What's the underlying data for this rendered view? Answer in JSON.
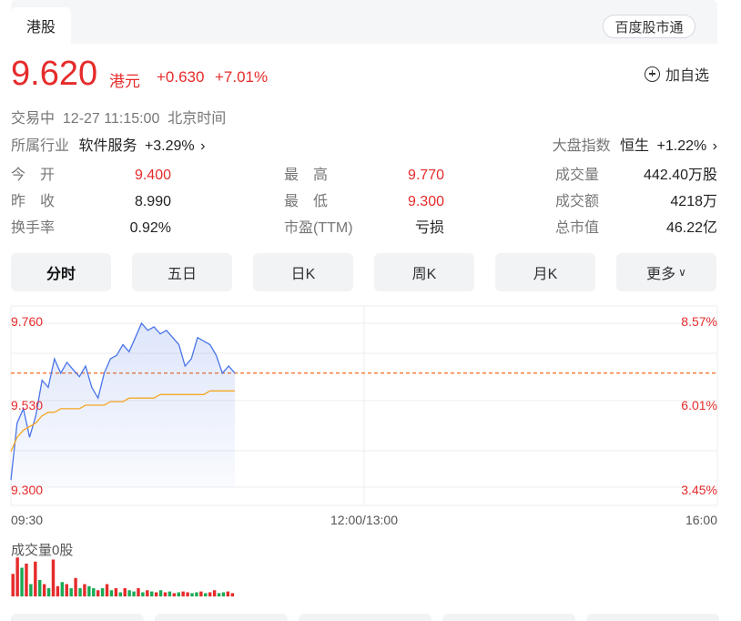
{
  "header": {
    "tab_label": "港股",
    "baidu_button": "百度股市通"
  },
  "quote": {
    "price": "9.620",
    "unit": "港元",
    "change": "+0.630",
    "change_pct": "+7.01%",
    "add_watch": "加自选",
    "status": "交易中  12-27 11:15:00  北京时间"
  },
  "industry": {
    "label": "所属行业",
    "name": "软件服务",
    "pct": "+3.29%"
  },
  "index": {
    "label": "大盘指数",
    "name": "恒生",
    "pct": "+1.22%"
  },
  "stats": [
    {
      "label": "今　开",
      "value": "9.400"
    },
    {
      "label": "最　高",
      "value": "9.770"
    },
    {
      "label": "成交量",
      "value": "442.40万股"
    },
    {
      "label": "昨　收",
      "value": "8.990"
    },
    {
      "label": "最　低",
      "value": "9.300"
    },
    {
      "label": "成交额",
      "value": "4218万"
    },
    {
      "label": "换手率",
      "value": "0.92%"
    },
    {
      "label": "市盈(TTM)",
      "value": "亏损"
    },
    {
      "label": "总市值",
      "value": "46.22亿"
    }
  ],
  "periods": [
    "分时",
    "五日",
    "日K",
    "周K",
    "月K",
    "更多"
  ],
  "colors": {
    "up": "#e62b2b",
    "price_line": "#4a74e8",
    "avg_line": "#f5a623",
    "down": "#1aaa55"
  },
  "chart_data": {
    "type": "line",
    "y_left_ticks": [
      "9.760",
      "9.530",
      "9.300"
    ],
    "y_right_ticks": [
      "8.57%",
      "6.01%",
      "3.45%"
    ],
    "x_ticks": [
      "09:30",
      "12:00/13:00",
      "16:00"
    ],
    "ylim": [
      9.3,
      9.76
    ],
    "session_points": 331,
    "prev_close_line": 9.62,
    "price": [
      9.32,
      9.48,
      9.52,
      9.44,
      9.5,
      9.6,
      9.58,
      9.66,
      9.62,
      9.65,
      9.63,
      9.61,
      9.64,
      9.58,
      9.55,
      9.62,
      9.66,
      9.67,
      9.7,
      9.68,
      9.72,
      9.76,
      9.74,
      9.75,
      9.73,
      9.74,
      9.72,
      9.7,
      9.64,
      9.66,
      9.72,
      9.71,
      9.7,
      9.67,
      9.62,
      9.64,
      9.62
    ],
    "avg": [
      9.4,
      9.44,
      9.46,
      9.47,
      9.48,
      9.5,
      9.51,
      9.51,
      9.52,
      9.52,
      9.52,
      9.52,
      9.53,
      9.53,
      9.53,
      9.53,
      9.54,
      9.54,
      9.54,
      9.55,
      9.55,
      9.55,
      9.55,
      9.55,
      9.56,
      9.56,
      9.56,
      9.56,
      9.56,
      9.56,
      9.56,
      9.56,
      9.57,
      9.57,
      9.57,
      9.57,
      9.57
    ],
    "volume_label": "成交量0股",
    "volume": [
      0.55,
      0.95,
      0.7,
      0.8,
      0.3,
      0.85,
      0.4,
      0.3,
      0.2,
      0.9,
      0.25,
      0.35,
      0.3,
      0.2,
      0.45,
      0.2,
      0.3,
      0.25,
      0.2,
      0.15,
      0.2,
      0.3,
      0.15,
      0.2,
      0.1,
      0.2,
      0.15,
      0.12,
      0.2,
      0.1,
      0.15,
      0.12,
      0.1,
      0.15,
      0.1,
      0.12,
      0.08,
      0.1,
      0.12,
      0.1,
      0.08,
      0.1,
      0.12,
      0.08,
      0.1,
      0.15,
      0.08,
      0.1,
      0.12,
      0.08
    ],
    "volume_dir": [
      "up",
      "up",
      "down",
      "up",
      "down",
      "up",
      "down",
      "up",
      "down",
      "up",
      "up",
      "down",
      "up",
      "down",
      "up",
      "down",
      "up",
      "down",
      "down",
      "up",
      "down",
      "up",
      "down",
      "up",
      "down",
      "up",
      "down",
      "down",
      "up",
      "down",
      "up",
      "down",
      "up",
      "down",
      "up",
      "down",
      "up",
      "down",
      "up",
      "up",
      "down",
      "down",
      "up",
      "down",
      "up",
      "up",
      "down",
      "down",
      "up",
      "up"
    ]
  }
}
